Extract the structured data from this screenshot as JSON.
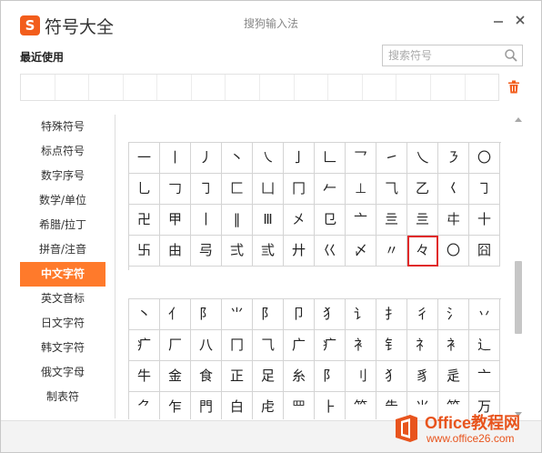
{
  "header": {
    "logo_glyph": "S",
    "title": "符号大全",
    "ime_title": "搜狗输入法",
    "minimize_icon": "minimize-icon",
    "close_icon": "close-icon"
  },
  "recent": {
    "label": "最近使用",
    "slot_count_visible": 14,
    "delete_icon": "trash-icon"
  },
  "search": {
    "placeholder": "搜索符号",
    "value": "",
    "icon": "search-icon"
  },
  "sidebar": {
    "items": [
      {
        "label": "特殊符号",
        "active": false
      },
      {
        "label": "标点符号",
        "active": false
      },
      {
        "label": "数字序号",
        "active": false
      },
      {
        "label": "数学/单位",
        "active": false
      },
      {
        "label": "希腊/拉丁",
        "active": false
      },
      {
        "label": "拼音/注音",
        "active": false
      },
      {
        "label": "中文字符",
        "active": true
      },
      {
        "label": "英文音标",
        "active": false
      },
      {
        "label": "日文字符",
        "active": false
      },
      {
        "label": "韩文字符",
        "active": false
      },
      {
        "label": "俄文字母",
        "active": false
      },
      {
        "label": "制表符",
        "active": false
      }
    ]
  },
  "section1": {
    "selected": "々",
    "rows": [
      [
        "一",
        "丨",
        "丿",
        "丶",
        "㇏",
        "亅",
        "𠃊",
        "乛",
        "㇀",
        "乀",
        "㇋",
        "〇"
      ],
      [
        "乚",
        "𠃌",
        "㇆",
        "匚",
        "凵",
        "冂",
        "𠂉",
        "⊥",
        "⺄",
        "乙",
        "𡿨",
        "㇆"
      ],
      [
        "卍",
        "甲",
        "丨",
        "‖",
        "Ⅲ",
        "㐅",
        "⺋",
        "亠",
        "亖",
        "亖",
        "㐄",
        "十"
      ],
      [
        "卐",
        "由",
        "㢧",
        "弍",
        "弎",
        "廾",
        "巜",
        "〆",
        "〃",
        "々",
        "〇",
        "囧"
      ]
    ]
  },
  "section2": {
    "rows": [
      [
        "丶",
        "⺅",
        "⻖",
        "⺌",
        "阝",
        "卩",
        "⺨",
        "讠",
        "扌",
        "彳",
        "⺡",
        "丷"
      ],
      [
        "疒",
        "厂",
        "⼋",
        "冂",
        "⺄",
        "广",
        "疒",
        "⻂",
        "钅",
        "礻",
        "衤",
        "辶"
      ],
      [
        "牛",
        "金",
        "食",
        "正",
        "足",
        "糸",
        "阝",
        "⺉",
        "犭",
        "豸",
        "辵",
        "亠"
      ],
      [
        "⺈",
        "乍",
        "門",
        "白",
        "虍",
        "罒",
        "⺊",
        "⺮",
        "⺧",
        "⺌",
        "⺮",
        "万"
      ]
    ]
  },
  "watermark": {
    "line1": "Office教程网",
    "line2": "www.office26.com",
    "icon": "office-logo-icon"
  }
}
